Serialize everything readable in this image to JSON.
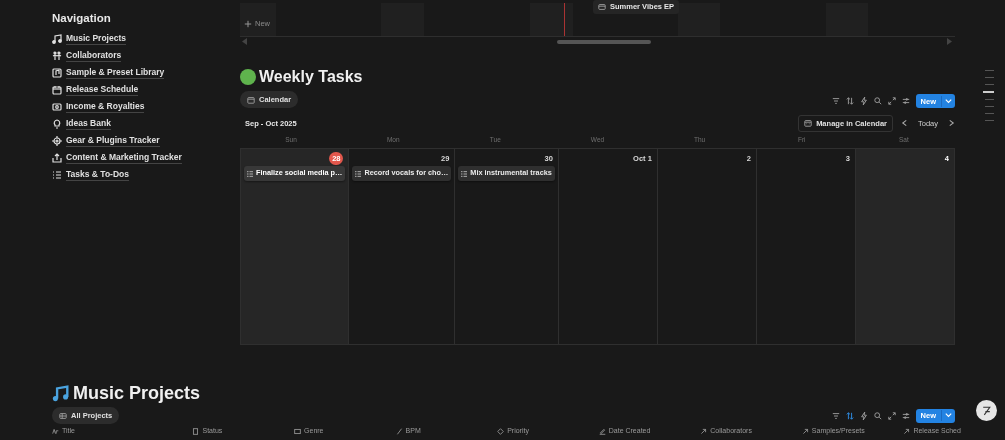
{
  "sidebar": {
    "title": "Navigation",
    "items": [
      {
        "label": "Music Projects"
      },
      {
        "label": "Collaborators"
      },
      {
        "label": "Sample & Preset Library"
      },
      {
        "label": "Release Schedule"
      },
      {
        "label": "Income & Royalties"
      },
      {
        "label": "Ideas Bank"
      },
      {
        "label": "Gear & Plugins Tracker"
      },
      {
        "label": "Content & Marketing Tracker"
      },
      {
        "label": "Tasks & To-Dos"
      }
    ]
  },
  "timeline": {
    "new_label": "New",
    "item": "Summer Vibes EP"
  },
  "weekly_tasks": {
    "title": "Weekly Tasks",
    "views": [
      {
        "label": "Calendar",
        "selected": true
      }
    ],
    "sort_active": false,
    "new_button": "New",
    "period": "Sep - Oct 2025",
    "manage_button": "Manage in Calendar",
    "today_button": "Today",
    "weekdays": [
      "Sun",
      "Mon",
      "Tue",
      "Wed",
      "Thu",
      "Fri",
      "Sat"
    ],
    "days": [
      {
        "label": "28",
        "today": true,
        "weekend": true,
        "tasks": [
          "Finalize social media p…"
        ]
      },
      {
        "label": "29",
        "today": false,
        "weekend": false,
        "tasks": [
          "Record vocals for cho…"
        ]
      },
      {
        "label": "30",
        "today": false,
        "weekend": false,
        "tasks": [
          "Mix instrumental tracks"
        ]
      },
      {
        "label": "Oct 1",
        "today": false,
        "weekend": false
      },
      {
        "label": "2",
        "today": false,
        "weekend": false
      },
      {
        "label": "3",
        "today": false,
        "weekend": false
      },
      {
        "label": "4",
        "today": false,
        "weekend": true
      }
    ]
  },
  "music_projects": {
    "title": "Music Projects",
    "views": [
      {
        "label": "All Projects",
        "selected": true
      }
    ],
    "sort_active": true,
    "new_button": "New",
    "columns": [
      "Title",
      "Status",
      "Genre",
      "BPM",
      "Priority",
      "Date Created",
      "Collaborators",
      "Samples/Presets",
      "Release Sched"
    ]
  }
}
